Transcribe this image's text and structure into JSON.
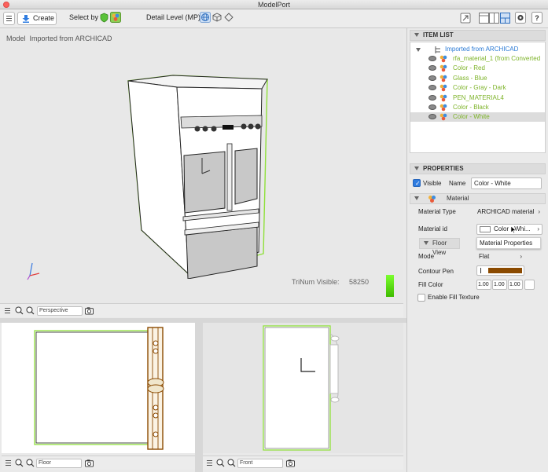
{
  "window": {
    "title": "ModelPort"
  },
  "toolbar": {
    "create_label": "Create",
    "select_by_label": "Select by",
    "detail_level_label": "Detail Level (MP)"
  },
  "viewport_main": {
    "label_prefix": "Model",
    "label": "Imported from ARCHICAD",
    "trinum_label": "TriNum Visible:",
    "trinum_value": "58250",
    "view_mode": "Perspective"
  },
  "viewport_floor": {
    "view_mode": "Floor"
  },
  "viewport_front": {
    "view_mode": "Front"
  },
  "item_list": {
    "title": "ITEM LIST",
    "root": "Imported from ARCHICAD",
    "items": [
      "rfa_material_1 (from Converted",
      "Color - Red",
      "Glass - Blue",
      "Color - Gray - Dark",
      "PEN_MATERIAL4",
      "Color - Black",
      "Color - White"
    ]
  },
  "properties": {
    "title": "PROPERTIES",
    "visible_label": "Visible",
    "name_label": "Name",
    "name_value": "Color - White",
    "material_section": "Material",
    "material_type_label": "Material Type",
    "material_type_value": "ARCHICAD material",
    "material_id_label": "Material id",
    "material_id_value": "Color - Whi...",
    "tooltip": "Material Properties",
    "floor_view_section": "Floor View",
    "mode_label": "Mode",
    "mode_value": "Flat",
    "contour_pen_label": "Contour Pen",
    "fill_color_label": "Fill Color",
    "fill_values": [
      "1.00",
      "1.00",
      "1.00"
    ],
    "enable_fill_texture_label": "Enable Fill Texture"
  },
  "colors": {
    "selection_green": "#8fe03a",
    "list_text_green": "#7db328",
    "root_blue": "#2a7ad5",
    "contour_pen_swatch": "#8b4a00"
  }
}
